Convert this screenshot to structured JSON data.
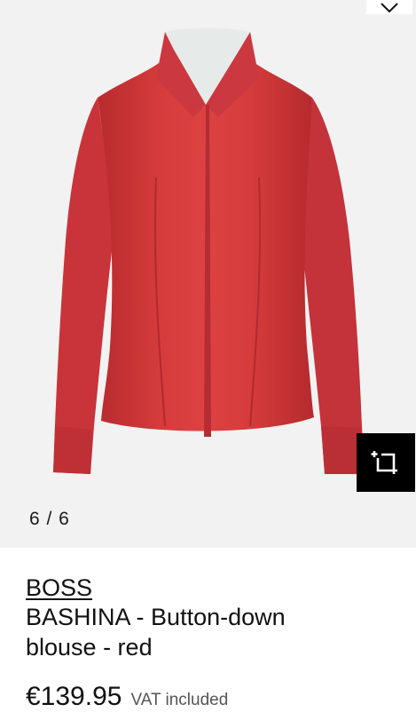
{
  "gallery": {
    "counter": "6 / 6",
    "image_alt": "Red button-down blouse",
    "wishlist_icon": "heart-icon",
    "similar_icon": "find-similar-icon"
  },
  "product": {
    "brand": "BOSS",
    "name_line1": "BASHINA - Button-down",
    "name_line2": "blouse - red",
    "price": "€139.95",
    "vat_note": "VAT included"
  },
  "colors": {
    "blouse": "#d23a3a",
    "background": "#f2f2f2",
    "button": "#000000"
  }
}
